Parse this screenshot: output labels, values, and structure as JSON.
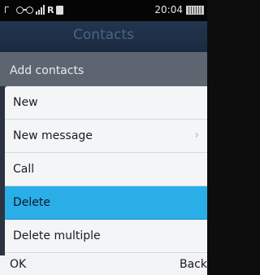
{
  "status_bar": {
    "roaming": "R",
    "time": "20:04"
  },
  "title_bar": {
    "title": "Contacts"
  },
  "subheader": {
    "label": "Add contacts"
  },
  "menu": {
    "items": [
      {
        "label": "New"
      },
      {
        "label": "New message",
        "has_submenu": true
      },
      {
        "label": "Call"
      },
      {
        "label": "Delete",
        "selected": true
      },
      {
        "label": "Delete multiple"
      }
    ]
  },
  "softkeys": {
    "left": "OK",
    "right": "Back"
  },
  "colors": {
    "selection": "#2aaee8",
    "title_bar": "#1f3049",
    "subheader": "#5d6570",
    "menu_bg": "#f4f5f7"
  }
}
